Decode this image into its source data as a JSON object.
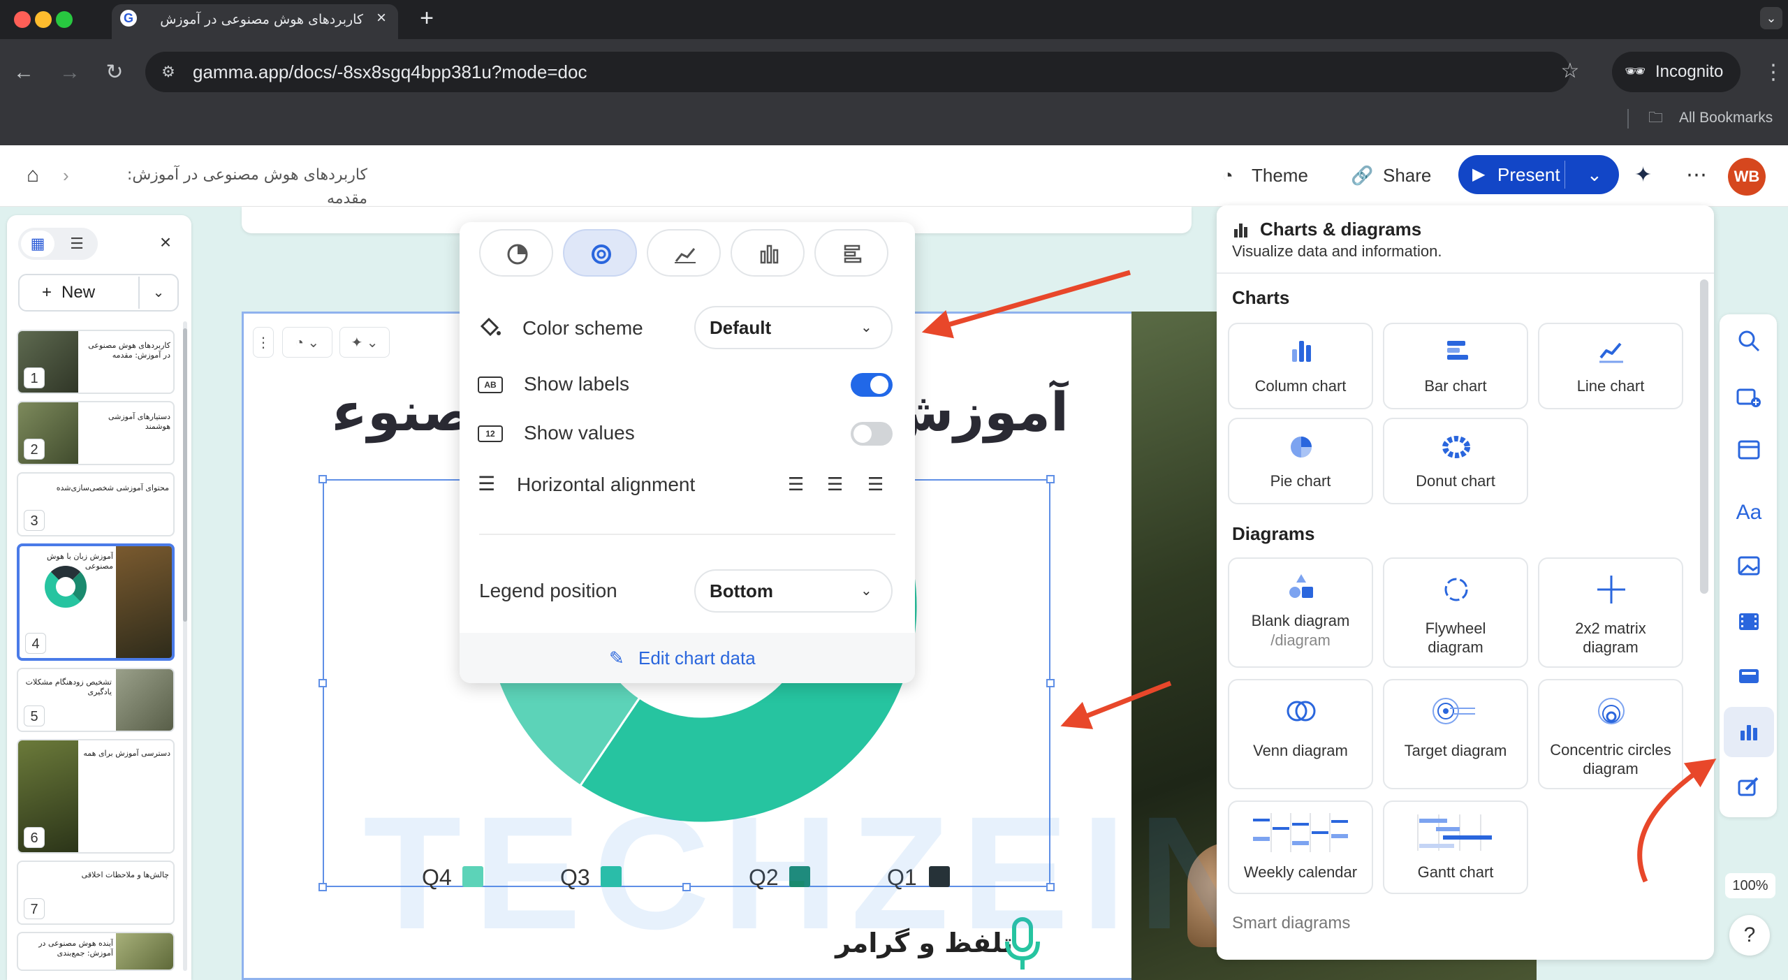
{
  "browser": {
    "tab_title": "کاربردهای هوش مصنوعی در آموزش",
    "tab_favicon": "G",
    "url": "gamma.app/docs/-8sx8sgq4bpp381u?mode=doc",
    "incognito_label": "Incognito",
    "bookmarks_label": "All Bookmarks"
  },
  "header": {
    "breadcrumb": "کاربردهای هوش مصنوعی در آموزش: مقدمه",
    "theme_label": "Theme",
    "share_label": "Share",
    "present_label": "Present",
    "avatar_initials": "WB"
  },
  "sidebar": {
    "new_label": "New",
    "slides": [
      {
        "num": "1",
        "title": "کاربردهای هوش مصنوعی در آموزش: مقدمه"
      },
      {
        "num": "2",
        "title": "دستیارهای آموزشی هوشمند"
      },
      {
        "num": "3",
        "title": "محتوای آموزشی شخصی‌سازی‌شده"
      },
      {
        "num": "4",
        "title": "آموزش زبان با هوش مصنوعی"
      },
      {
        "num": "5",
        "title": "تشخیص زودهنگام مشکلات یادگیری"
      },
      {
        "num": "6",
        "title": "دسترسی آموزش برای همه"
      },
      {
        "num": "7",
        "title": "چالش‌ها و ملاحظات اخلاقی"
      },
      {
        "num": "",
        "title": "آینده هوش مصنوعی در آموزش: جمع‌بندی"
      }
    ]
  },
  "slide": {
    "heading": "آموزش زبان با هوش مصنوعی",
    "bottom_text": "تلفظ و گرامر",
    "watermark": "TECHZEIN"
  },
  "chart_popup": {
    "color_scheme_label": "Color scheme",
    "color_scheme_value": "Default",
    "show_labels_label": "Show labels",
    "show_labels_on": true,
    "show_values_label": "Show values",
    "show_values_on": false,
    "horizontal_alignment_label": "Horizontal alignment",
    "legend_position_label": "Legend position",
    "legend_position_value": "Bottom",
    "edit_chart_data_label": "Edit chart data"
  },
  "chart_data": {
    "type": "pie",
    "categories": [
      "Q1",
      "Q2",
      "Q3",
      "Q4"
    ],
    "values": [
      0,
      25,
      45,
      30
    ],
    "colors": [
      "#263238",
      "#1a8a6e",
      "#26c4a0",
      "#5cd3b8"
    ],
    "legend": "bottom",
    "title": "",
    "xlabel": "",
    "ylabel": ""
  },
  "right_panel": {
    "title": "Charts & diagrams",
    "subtitle": "Visualize data and information.",
    "charts_heading": "Charts",
    "diagrams_heading": "Diagrams",
    "smart_heading": "Smart diagrams",
    "charts": [
      {
        "label": "Column chart"
      },
      {
        "label": "Bar chart"
      },
      {
        "label": "Line chart"
      },
      {
        "label": "Pie chart"
      },
      {
        "label": "Donut chart"
      }
    ],
    "diagrams": [
      {
        "label": "Blank diagram",
        "sub": "/diagram"
      },
      {
        "label": "Flywheel diagram"
      },
      {
        "label": "2x2 matrix diagram"
      },
      {
        "label": "Venn diagram"
      },
      {
        "label": "Target diagram"
      },
      {
        "label": "Concentric circles diagram"
      },
      {
        "label": "Weekly calendar"
      },
      {
        "label": "Gantt chart"
      }
    ]
  },
  "rail": {
    "zoom": "100%",
    "help": "?"
  },
  "colors": {
    "accent": "#1246c7",
    "arrow": "#e8472a",
    "teal": "#26c4a0"
  }
}
